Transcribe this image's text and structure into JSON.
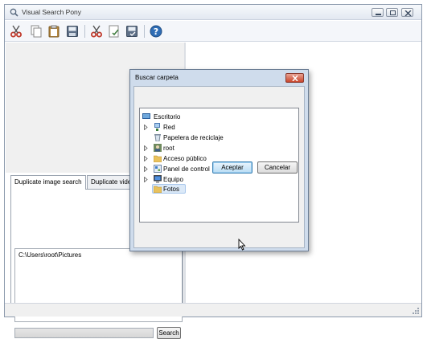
{
  "window": {
    "title": "Visual Search Pony"
  },
  "toolbar": {
    "buttons": [
      {
        "icon": "cut-icon"
      },
      {
        "icon": "copy-icon"
      },
      {
        "icon": "paste-icon"
      },
      {
        "icon": "save-icon"
      },
      {
        "icon": "cut-alt-icon"
      },
      {
        "icon": "document-check-icon"
      },
      {
        "icon": "document-save-icon"
      },
      {
        "icon": "help-icon"
      }
    ]
  },
  "left_pane": {
    "tabs": [
      {
        "label": "Duplicate image search"
      },
      {
        "label": "Duplicate video search"
      }
    ],
    "folders": [
      "C:\\Users\\root\\Pictures"
    ],
    "search_label": "Search"
  },
  "dialog": {
    "title": "Buscar carpeta",
    "tree": [
      {
        "label": "Escritorio",
        "icon": "desktop-icon",
        "expandable": false,
        "selected": false
      },
      {
        "label": "Red",
        "icon": "network-icon",
        "expandable": true,
        "selected": false
      },
      {
        "label": "Papelera de reciclaje",
        "icon": "recycle-bin-icon",
        "expandable": false,
        "selected": false
      },
      {
        "label": "root",
        "icon": "user-folder-icon",
        "expandable": true,
        "selected": false
      },
      {
        "label": "Acceso público",
        "icon": "folder-icon",
        "expandable": true,
        "selected": false
      },
      {
        "label": "Panel de control",
        "icon": "control-panel-icon",
        "expandable": true,
        "selected": false
      },
      {
        "label": "Equipo",
        "icon": "computer-icon",
        "expandable": true,
        "selected": false
      },
      {
        "label": "Fotos",
        "icon": "folder-icon",
        "expandable": false,
        "selected": true
      }
    ],
    "accept_label": "Aceptar",
    "cancel_label": "Cancelar"
  },
  "colors": {
    "selection_bg": "#dbe9f8",
    "dialog_frame": "#cfdcec",
    "close_button": "#c9462c"
  }
}
